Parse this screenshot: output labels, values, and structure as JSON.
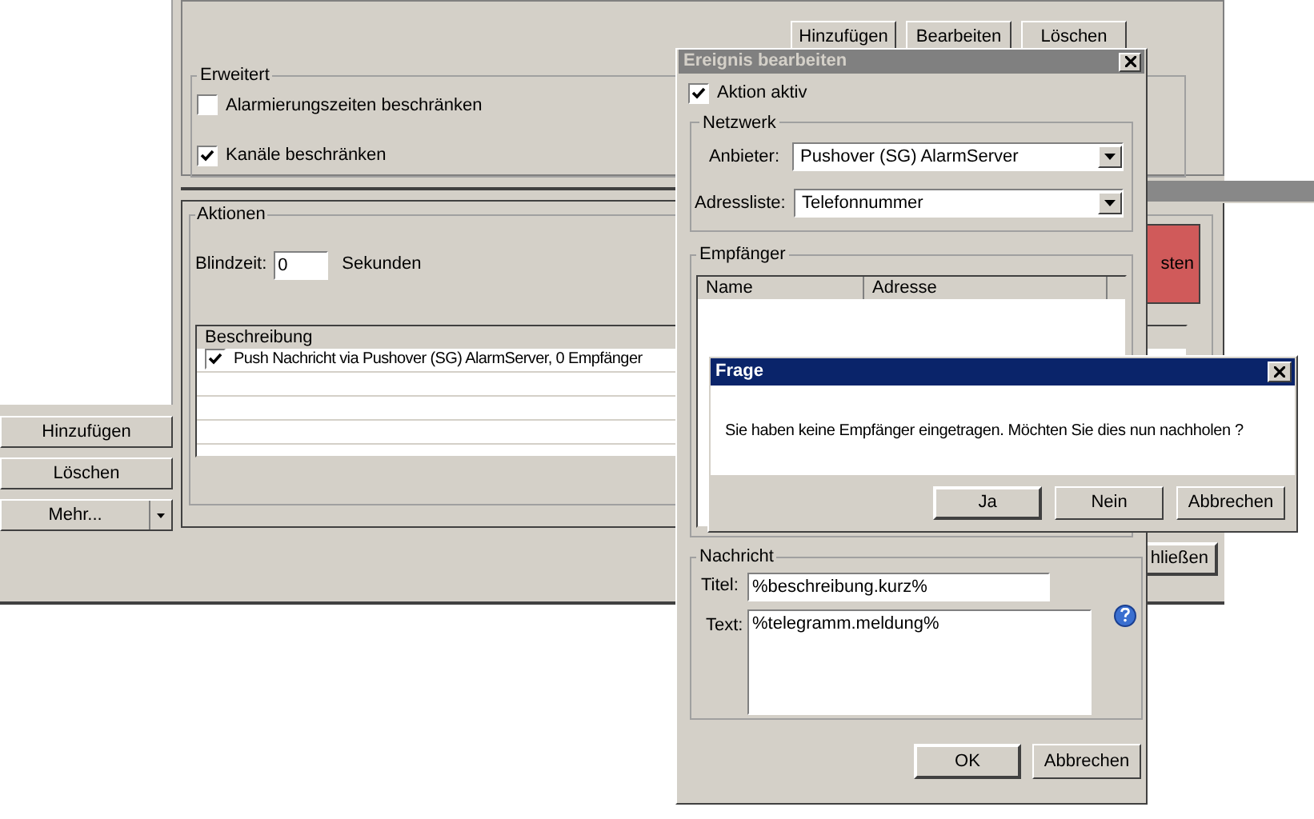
{
  "main_window": {
    "left_buttons": [
      "Hinzufügen",
      "Löschen"
    ],
    "more_button": "Mehr...",
    "list_buttons": [
      "Hinzufügen",
      "Bearbeiten",
      "Löschen"
    ],
    "advanced": {
      "title": "Erweitert",
      "options": [
        {
          "label": "Alarmierungszeiten beschränken",
          "checked": false
        },
        {
          "label": "Kanäle beschränken",
          "checked": true
        }
      ]
    },
    "actions": {
      "title": "Aktionen",
      "blind_label": "Blindzeit:",
      "blind_value": "0",
      "blind_unit": "Sekunden",
      "table": {
        "columns": [
          "Beschreibung"
        ],
        "rows": [
          {
            "checked": true,
            "text": "Push Nachricht via Pushover (SG) AlarmServer, 0 Empfänger"
          }
        ]
      }
    },
    "red_button": "sten",
    "close_button": "hließen"
  },
  "event_dialog": {
    "title": "Ereignis bearbeiten",
    "active": {
      "label": "Aktion aktiv",
      "checked": true
    },
    "network": {
      "title": "Netzwerk",
      "provider_label": "Anbieter:",
      "provider": "Pushover (SG) AlarmServer",
      "list_label": "Adressliste:",
      "list": "Telefonnummer"
    },
    "recipients": {
      "title": "Empfänger",
      "columns": [
        "Name",
        "Adresse"
      ]
    },
    "message": {
      "title": "Nachricht",
      "title_label": "Titel:",
      "title_value": "%beschreibung.kurz%",
      "text_label": "Text:",
      "text_value": "%telegramm.meldung%"
    },
    "buttons": [
      "OK",
      "Abbrechen"
    ]
  },
  "question_dialog": {
    "title": "Frage",
    "message": "Sie haben keine Empfänger eingetragen. Möchten Sie dies nun nachholen ?",
    "buttons": [
      "Ja",
      "Nein",
      "Abbrechen"
    ]
  }
}
